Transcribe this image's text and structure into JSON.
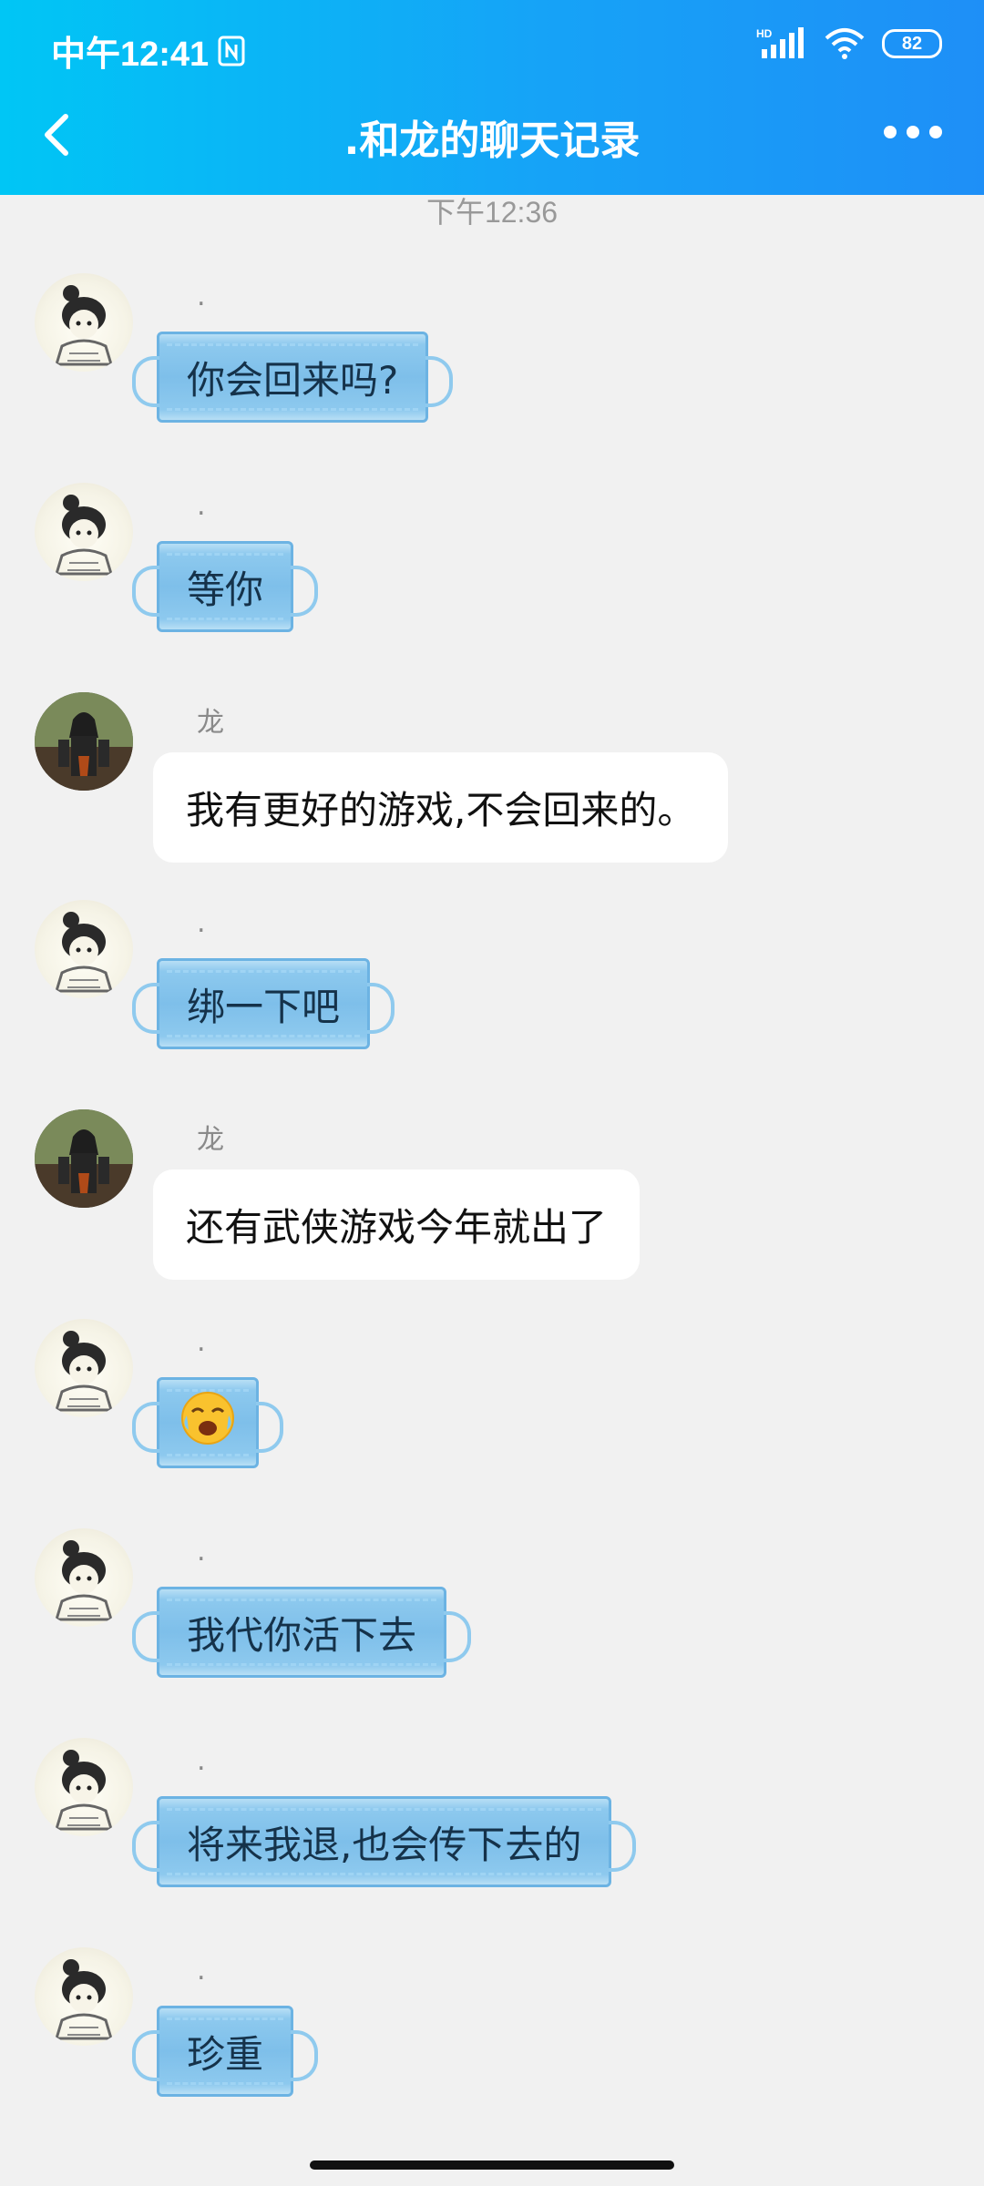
{
  "status_bar": {
    "time": "中午12:41",
    "network": "HD",
    "battery": "82"
  },
  "header": {
    "title": ".和龙的聊天记录"
  },
  "timestamp": "下午12:36",
  "messages": [
    {
      "sender": ".",
      "text": "你会回来吗?",
      "style": "mask"
    },
    {
      "sender": ".",
      "text": "等你",
      "style": "mask"
    },
    {
      "sender": "龙",
      "text": "我有更好的游戏,不会回来的。",
      "style": "white"
    },
    {
      "sender": ".",
      "text": "绑一下吧",
      "style": "mask"
    },
    {
      "sender": "龙",
      "text": "还有武侠游戏今年就出了",
      "style": "white"
    },
    {
      "sender": ".",
      "text": "😭",
      "style": "mask"
    },
    {
      "sender": ".",
      "text": "我代你活下去",
      "style": "mask"
    },
    {
      "sender": ".",
      "text": "将来我退,也会传下去的",
      "style": "mask"
    },
    {
      "sender": ".",
      "text": "珍重",
      "style": "mask"
    }
  ],
  "colors": {
    "header_start": "#00c6f5",
    "header_end": "#1e8ff7",
    "background": "#f1f1f1",
    "mask_blue": "#7ebfea"
  }
}
